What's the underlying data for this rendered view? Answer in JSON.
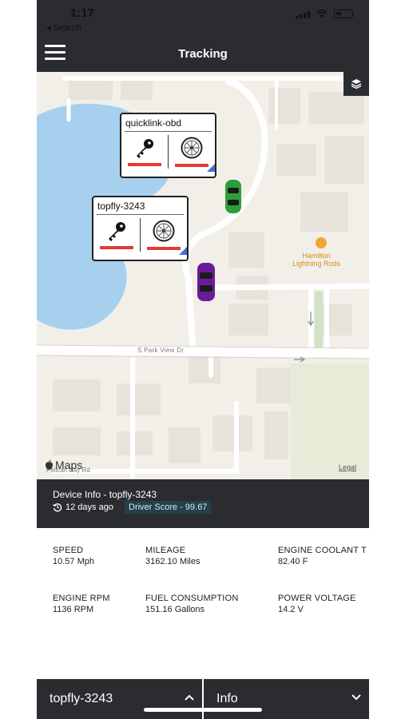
{
  "status": {
    "time": "1:17",
    "back_label": "◂ Search"
  },
  "header": {
    "title": "Tracking"
  },
  "map": {
    "street_label": "S Park View Dr",
    "poi_label": "Hamilton\nLightning Rods",
    "attribution": "Maps",
    "legal_label": "Legal",
    "bottom_street": "Pelican Bay Rd",
    "callouts": [
      {
        "name": "quicklink-obd"
      },
      {
        "name": "topfly-3243"
      }
    ],
    "colors": {
      "water": "#a6d0ee",
      "road": "#ffffff",
      "block": "#e6e2da",
      "car_green": "#2e9e3a",
      "car_purple": "#6a1b9a",
      "alert": "#e53935",
      "corner": "#3f6fd6"
    }
  },
  "device": {
    "title": "Device Info - topfly-3243",
    "last_seen": "12 days ago",
    "driver_score": "Driver Score - 99.67"
  },
  "stats": [
    {
      "label": "SPEED",
      "value": "10.57 Mph"
    },
    {
      "label": "MILEAGE",
      "value": "3162.10 Miles"
    },
    {
      "label": "ENGINE COOLANT T",
      "value": "82.40 F"
    },
    {
      "label": "ENGINE RPM",
      "value": "1136 RPM"
    },
    {
      "label": "FUEL CONSUMPTION",
      "value": "151.16 Gallons"
    },
    {
      "label": "POWER VOLTAGE",
      "value": "14.2 V"
    }
  ],
  "bottom": {
    "device_select": "topfly-3243",
    "view_select": "Info"
  }
}
